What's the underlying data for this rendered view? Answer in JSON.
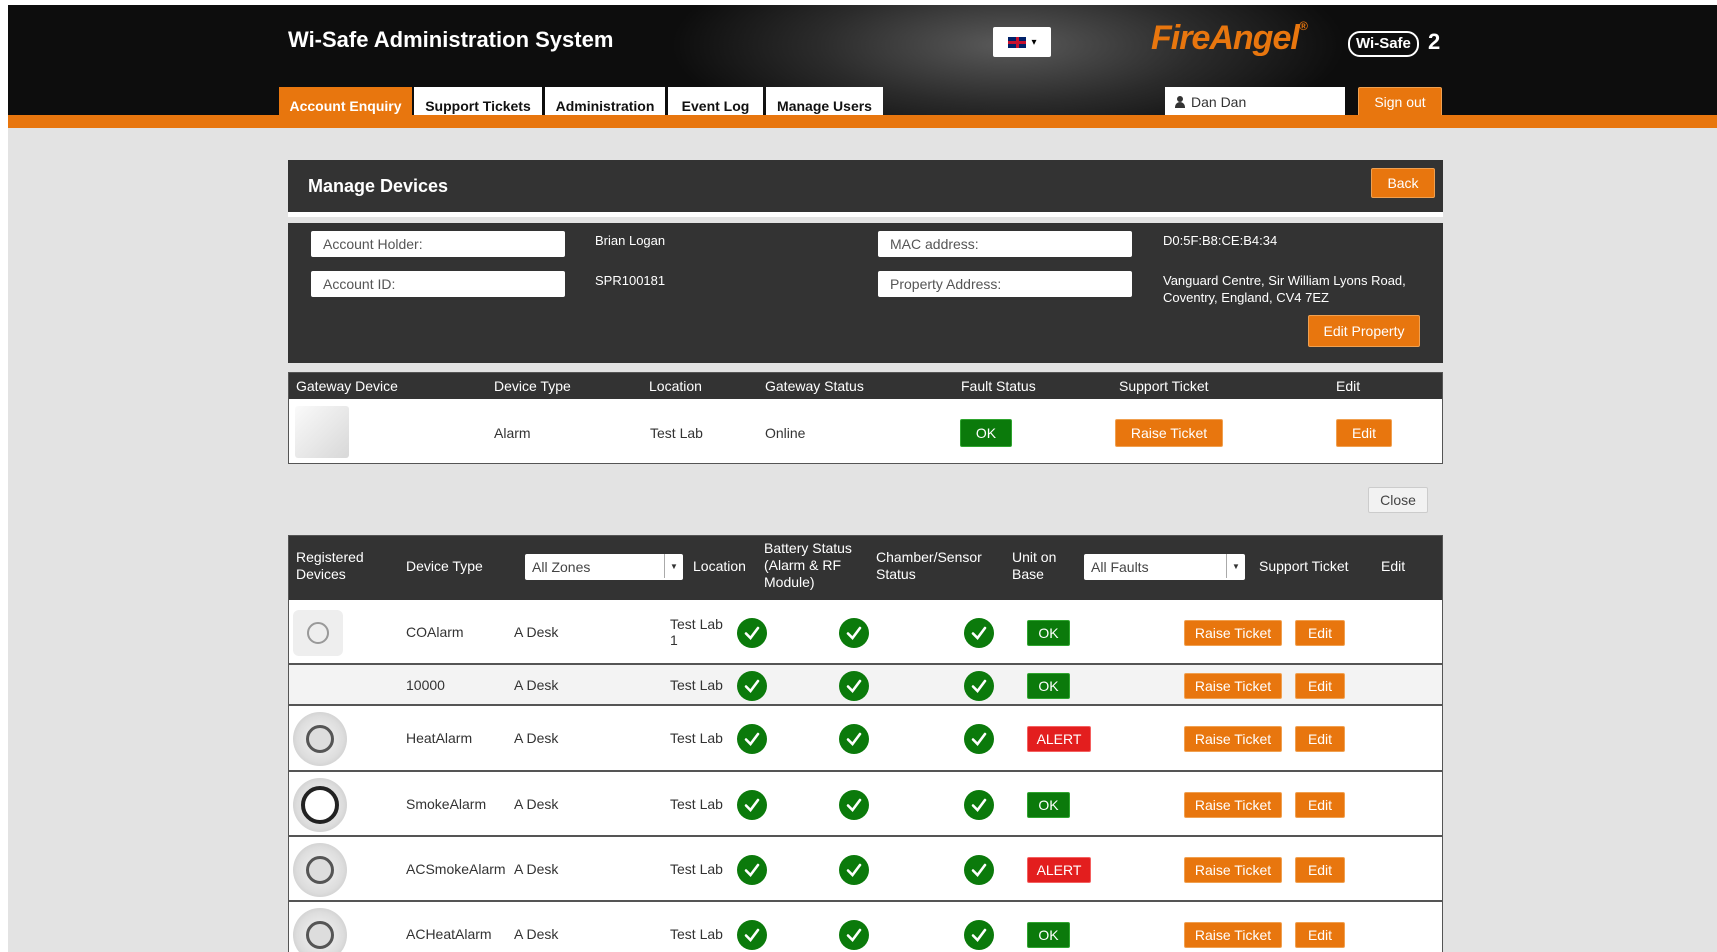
{
  "header": {
    "app_title": "Wi-Safe Administration System",
    "logo_text": "FireAngel",
    "logo_reg": "®",
    "wisafe_badge": "Wi-Safe",
    "wisafe_version": "2",
    "language_icon": "uk-flag-icon",
    "user_name": "Dan Dan",
    "sign_out_label": "Sign out",
    "accent_color": "#e8760e"
  },
  "nav": {
    "tabs": [
      {
        "label": "Account Enquiry",
        "active": true
      },
      {
        "label": "Support Tickets",
        "active": false
      },
      {
        "label": "Administration",
        "active": false
      },
      {
        "label": "Event Log",
        "active": false
      },
      {
        "label": "Manage Users",
        "active": false
      }
    ]
  },
  "manage_devices": {
    "title": "Manage Devices",
    "back_label": "Back",
    "account_holder_label": "Account Holder:",
    "account_holder_value": "Brian Logan",
    "account_id_label": "Account ID:",
    "account_id_value": "SPR100181",
    "mac_label": "MAC address:",
    "mac_value": "D0:5F:B8:CE:B4:34",
    "property_label": "Property Address:",
    "property_line1": "Vanguard Centre, Sir William Lyons Road,",
    "property_line2": "Coventry, England, CV4 7EZ",
    "edit_property_label": "Edit Property"
  },
  "gateway": {
    "headers": [
      "Gateway Device",
      "Device Type",
      "Location",
      "Gateway Status",
      "Fault Status",
      "Support Ticket",
      "Edit"
    ],
    "row": {
      "device_type": "Alarm",
      "location": "Test Lab",
      "status": "Online",
      "fault": "OK",
      "ticket_label": "Raise Ticket",
      "edit_label": "Edit"
    }
  },
  "close_label": "Close",
  "devices": {
    "headers": {
      "registered": [
        "Registered",
        "Devices"
      ],
      "device_type": "Device Type",
      "zone_filter": "All Zones",
      "location": "Location",
      "battery": [
        "Battery Status",
        "(Alarm & RF",
        "Module)"
      ],
      "chamber": [
        "Chamber/Sensor",
        "Status"
      ],
      "unit_on_base": [
        "Unit on",
        "Base"
      ],
      "fault_filter": "All Faults",
      "support_ticket": "Support Ticket",
      "edit": "Edit"
    },
    "ticket_label": "Raise Ticket",
    "edit_label": "Edit",
    "rows": [
      {
        "device_type": "COAlarm",
        "zone": "A Desk",
        "location": "Test Lab 1",
        "fault": "OK",
        "image": "co-alarm-image"
      },
      {
        "device_type": "10000",
        "zone": "A Desk",
        "location": "Test Lab",
        "fault": "OK",
        "image": ""
      },
      {
        "device_type": "HeatAlarm",
        "zone": "A Desk",
        "location": "Test Lab",
        "fault": "ALERT",
        "image": "heat-alarm-image"
      },
      {
        "device_type": "SmokeAlarm",
        "zone": "A Desk",
        "location": "Test Lab",
        "fault": "OK",
        "image": "smoke-alarm-image"
      },
      {
        "device_type": "ACSmokeAlarm",
        "zone": "A Desk",
        "location": "Test Lab",
        "fault": "ALERT",
        "image": "ac-smoke-alarm-image"
      },
      {
        "device_type": "ACHeatAlarm",
        "zone": "A Desk",
        "location": "Test Lab",
        "fault": "OK",
        "image": "ac-heat-alarm-image"
      }
    ]
  }
}
